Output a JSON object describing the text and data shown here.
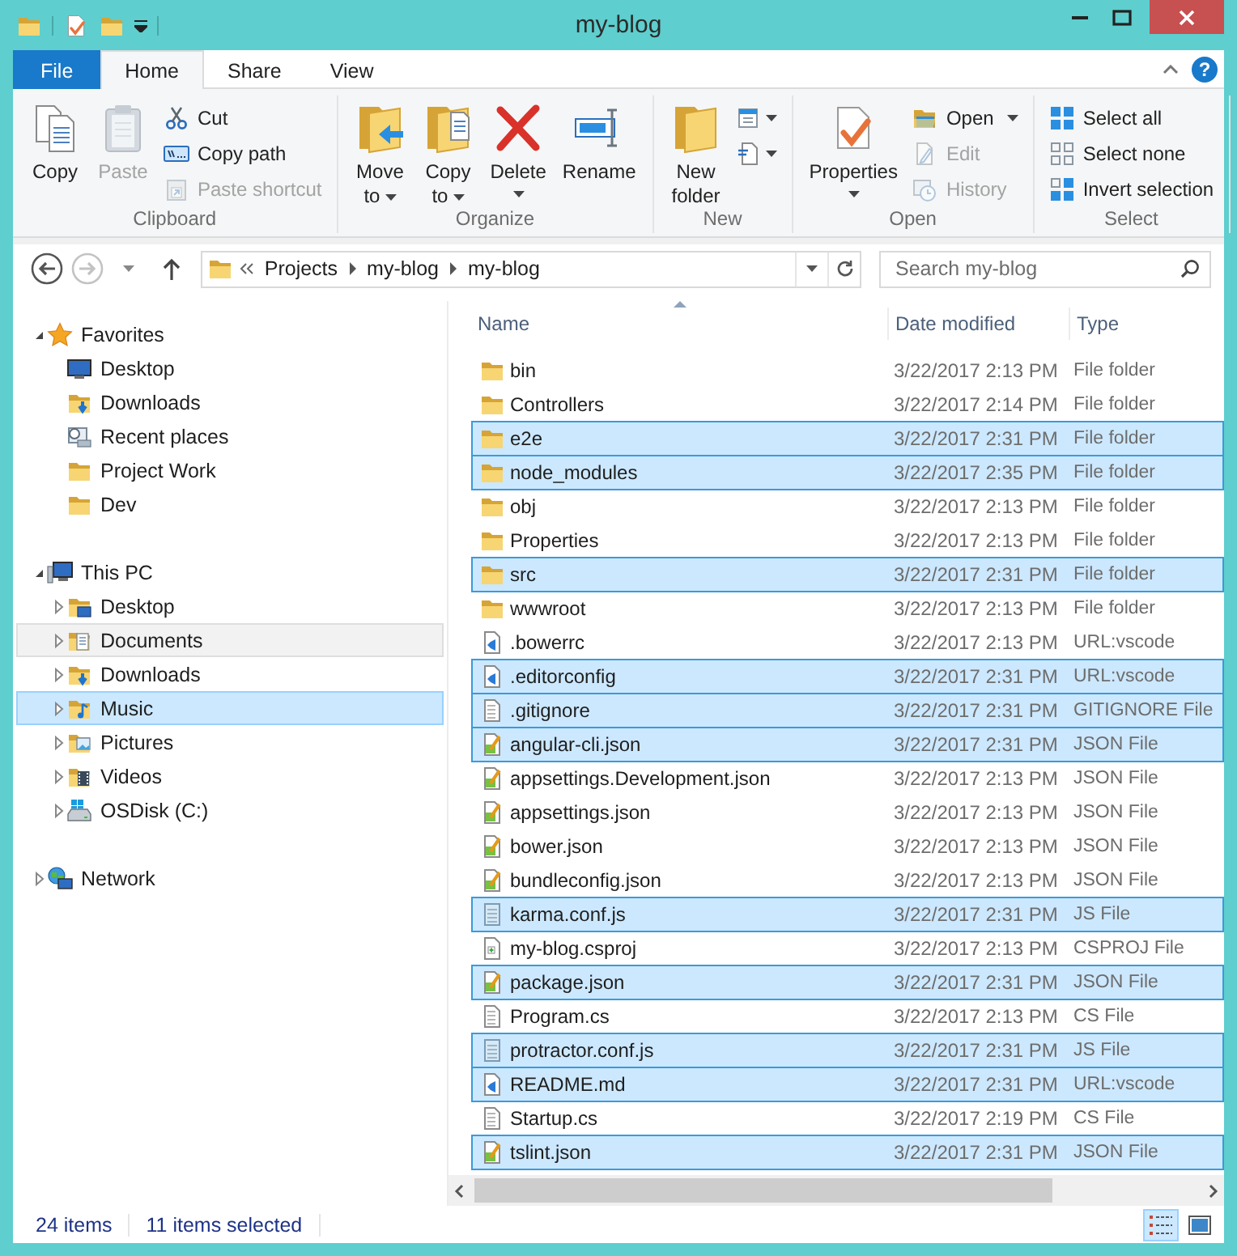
{
  "window": {
    "title": "my-blog"
  },
  "ribbon_tabs": [
    {
      "label": "File",
      "kind": "menu",
      "selected": false
    },
    {
      "label": "Home",
      "kind": "tab",
      "selected": true
    },
    {
      "label": "Share",
      "kind": "tab",
      "selected": false
    },
    {
      "label": "View",
      "kind": "tab",
      "selected": false
    }
  ],
  "help_button": "?",
  "ribbon_groups": [
    {
      "label": "Clipboard",
      "items": [
        {
          "kind": "large",
          "label": "Copy",
          "dropdown": false,
          "disabled": false
        },
        {
          "kind": "large",
          "label": "Paste",
          "dropdown": false,
          "disabled": true
        },
        {
          "kind": "small",
          "label": "Cut",
          "dropdown": false,
          "disabled": false
        },
        {
          "kind": "small",
          "label": "Copy path",
          "dropdown": false,
          "disabled": false
        },
        {
          "kind": "small",
          "label": "Paste shortcut",
          "dropdown": false,
          "disabled": true
        }
      ]
    },
    {
      "label": "Organize",
      "items": [
        {
          "kind": "large",
          "label": "Move to",
          "dropdown": true,
          "disabled": false
        },
        {
          "kind": "large",
          "label": "Copy to",
          "dropdown": true,
          "disabled": false
        },
        {
          "kind": "large",
          "label": "Delete",
          "dropdown": true,
          "disabled": false
        },
        {
          "kind": "large",
          "label": "Rename",
          "dropdown": false,
          "disabled": false
        }
      ]
    },
    {
      "label": "New",
      "items": [
        {
          "kind": "large",
          "label": "New folder",
          "dropdown": false,
          "disabled": false
        },
        {
          "kind": "icon",
          "dropdown": true,
          "disabled": false
        },
        {
          "kind": "icon",
          "dropdown": true,
          "disabled": false
        }
      ]
    },
    {
      "label": "Open",
      "items": [
        {
          "kind": "large",
          "label": "Properties",
          "dropdown": true,
          "disabled": false
        },
        {
          "kind": "small",
          "label": "Open",
          "dropdown": true,
          "disabled": false
        },
        {
          "kind": "small",
          "label": "Edit",
          "dropdown": false,
          "disabled": true
        },
        {
          "kind": "small",
          "label": "History",
          "dropdown": false,
          "disabled": true
        }
      ]
    },
    {
      "label": "Select",
      "items": [
        {
          "kind": "small",
          "label": "Select all",
          "dropdown": false,
          "disabled": false
        },
        {
          "kind": "small",
          "label": "Select none",
          "dropdown": false,
          "disabled": false
        },
        {
          "kind": "small",
          "label": "Invert selection",
          "dropdown": false,
          "disabled": false
        }
      ]
    }
  ],
  "back": {
    "disabled": false
  },
  "forward": {
    "disabled": true
  },
  "address": {
    "path": [
      "Projects",
      "my-blog",
      "my-blog"
    ]
  },
  "search": {
    "placeholder": "Search my-blog"
  },
  "navigation": [
    {
      "label": "Favorites",
      "kind": "favorites",
      "expanded": true,
      "selected": false,
      "children": [
        {
          "label": "Desktop",
          "kind": "desktop",
          "selected": false
        },
        {
          "label": "Downloads",
          "kind": "downloads",
          "selected": false
        },
        {
          "label": "Recent places",
          "kind": "recent",
          "selected": false
        },
        {
          "label": "Project Work",
          "kind": "folder",
          "selected": false
        },
        {
          "label": "Dev",
          "kind": "folder",
          "selected": false
        }
      ]
    },
    {
      "label": "This PC",
      "kind": "computer",
      "expanded": true,
      "selected": false,
      "children": [
        {
          "label": "Desktop",
          "kind": "desktop-folder",
          "expanded": false,
          "selected": false,
          "hovered": false
        },
        {
          "label": "Documents",
          "kind": "documents",
          "expanded": false,
          "selected": false,
          "hovered": true
        },
        {
          "label": "Downloads",
          "kind": "downloads",
          "expanded": false,
          "selected": false,
          "hovered": false
        },
        {
          "label": "Music",
          "kind": "music",
          "expanded": false,
          "selected": true,
          "hovered": false
        },
        {
          "label": "Pictures",
          "kind": "pictures",
          "expanded": false,
          "selected": false,
          "hovered": false
        },
        {
          "label": "Videos",
          "kind": "videos",
          "expanded": false,
          "selected": false,
          "hovered": false
        },
        {
          "label": "OSDisk (C:)",
          "kind": "drive",
          "expanded": false,
          "selected": false,
          "hovered": false
        }
      ]
    },
    {
      "label": "Network",
      "kind": "network",
      "expanded": false,
      "selected": false
    }
  ],
  "columns": [
    {
      "label": "Name",
      "sorted": true
    },
    {
      "label": "Date modified",
      "sorted": false
    },
    {
      "label": "Type",
      "sorted": false
    }
  ],
  "files": [
    {
      "name": "bin",
      "date": "3/22/2017 2:13 PM",
      "type": "File folder",
      "kind": "folder",
      "selected": false
    },
    {
      "name": "Controllers",
      "date": "3/22/2017 2:14 PM",
      "type": "File folder",
      "kind": "folder",
      "selected": false
    },
    {
      "name": "e2e",
      "date": "3/22/2017 2:31 PM",
      "type": "File folder",
      "kind": "folder",
      "selected": true
    },
    {
      "name": "node_modules",
      "date": "3/22/2017 2:35 PM",
      "type": "File folder",
      "kind": "folder",
      "selected": true
    },
    {
      "name": "obj",
      "date": "3/22/2017 2:13 PM",
      "type": "File folder",
      "kind": "folder",
      "selected": false
    },
    {
      "name": "Properties",
      "date": "3/22/2017 2:13 PM",
      "type": "File folder",
      "kind": "folder",
      "selected": false
    },
    {
      "name": "src",
      "date": "3/22/2017 2:31 PM",
      "type": "File folder",
      "kind": "folder",
      "selected": true
    },
    {
      "name": "wwwroot",
      "date": "3/22/2017 2:13 PM",
      "type": "File folder",
      "kind": "folder",
      "selected": false
    },
    {
      "name": ".bowerrc",
      "date": "3/22/2017 2:13 PM",
      "type": "URL:vscode",
      "kind": "code",
      "selected": false
    },
    {
      "name": ".editorconfig",
      "date": "3/22/2017 2:31 PM",
      "type": "URL:vscode",
      "kind": "code",
      "selected": true
    },
    {
      "name": ".gitignore",
      "date": "3/22/2017 2:31 PM",
      "type": "GITIGNORE File",
      "kind": "text",
      "selected": true
    },
    {
      "name": "angular-cli.json",
      "date": "3/22/2017 2:31 PM",
      "type": "JSON File",
      "kind": "json",
      "selected": true
    },
    {
      "name": "appsettings.Development.json",
      "date": "3/22/2017 2:13 PM",
      "type": "JSON File",
      "kind": "json",
      "selected": false
    },
    {
      "name": "appsettings.json",
      "date": "3/22/2017 2:13 PM",
      "type": "JSON File",
      "kind": "json",
      "selected": false
    },
    {
      "name": "bower.json",
      "date": "3/22/2017 2:13 PM",
      "type": "JSON File",
      "kind": "json",
      "selected": false
    },
    {
      "name": "bundleconfig.json",
      "date": "3/22/2017 2:13 PM",
      "type": "JSON File",
      "kind": "json",
      "selected": false
    },
    {
      "name": "karma.conf.js",
      "date": "3/22/2017 2:31 PM",
      "type": "JS File",
      "kind": "script",
      "selected": true
    },
    {
      "name": "my-blog.csproj",
      "date": "3/22/2017 2:13 PM",
      "type": "CSPROJ File",
      "kind": "project",
      "selected": false
    },
    {
      "name": "package.json",
      "date": "3/22/2017 2:31 PM",
      "type": "JSON File",
      "kind": "json",
      "selected": true
    },
    {
      "name": "Program.cs",
      "date": "3/22/2017 2:13 PM",
      "type": "CS File",
      "kind": "text",
      "selected": false
    },
    {
      "name": "protractor.conf.js",
      "date": "3/22/2017 2:31 PM",
      "type": "JS File",
      "kind": "script",
      "selected": true
    },
    {
      "name": "README.md",
      "date": "3/22/2017 2:31 PM",
      "type": "URL:vscode",
      "kind": "code",
      "selected": true
    },
    {
      "name": "Startup.cs",
      "date": "3/22/2017 2:19 PM",
      "type": "CS File",
      "kind": "text",
      "selected": false
    },
    {
      "name": "tslint.json",
      "date": "3/22/2017 2:31 PM",
      "type": "JSON File",
      "kind": "json",
      "selected": true
    }
  ],
  "status_bar": {
    "item_count": "24 items",
    "selection": "11 items selected"
  },
  "view_buttons": [
    {
      "kind": "details",
      "selected": true
    },
    {
      "kind": "large-icons",
      "selected": false
    }
  ]
}
